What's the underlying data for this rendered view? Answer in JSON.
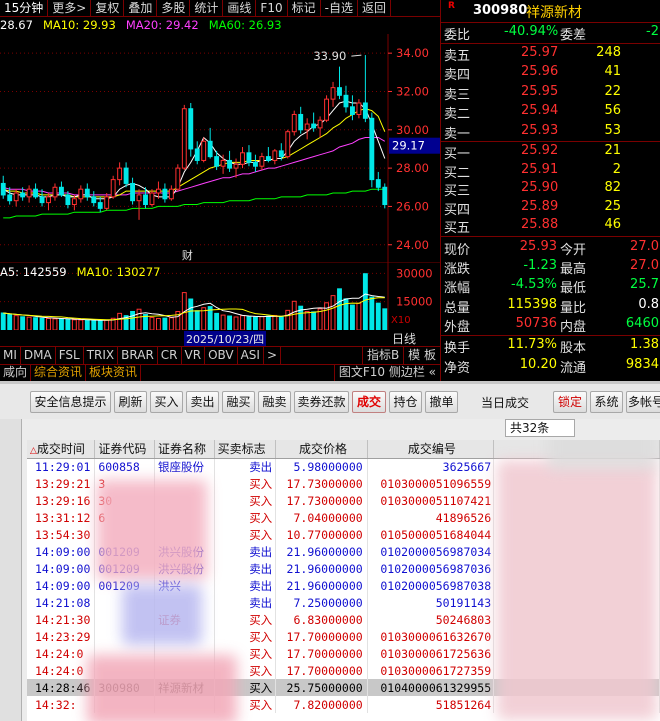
{
  "top_menu": {
    "items": [
      {
        "label": "15分钟",
        "active": true
      },
      {
        "label": "更多>"
      },
      {
        "label": "复权"
      },
      {
        "label": "叠加"
      },
      {
        "label": "多股"
      },
      {
        "label": "统计"
      },
      {
        "label": "画线"
      },
      {
        "label": "F10"
      },
      {
        "label": "标记"
      },
      {
        "label": "-自选"
      },
      {
        "label": "返回"
      }
    ]
  },
  "price_legend": [
    {
      "text": "28.67",
      "color": "#ffffff"
    },
    {
      "text": "MA10: 29.93",
      "color": "#ffff00"
    },
    {
      "text": "MA20: 29.42",
      "color": "#ff40ff"
    },
    {
      "text": "MA60: 26.93",
      "color": "#00ff00"
    }
  ],
  "colors": {
    "up": "#ff3030",
    "down": "#00e8e8",
    "ma5": "#ffffff",
    "ma10": "#ffff00",
    "ma20": "#ff40ff",
    "ma60": "#00ff00",
    "grid": "#7a0000",
    "price_axis": "#ff3030"
  },
  "chart_data": [
    {
      "type": "candlestick",
      "period": "15分钟",
      "ylim": [
        23.1,
        35.0
      ],
      "y_ticks": [
        "34.00",
        "32.00",
        "30.00",
        "28.00",
        "26.00",
        "24.00"
      ],
      "current_price_label": "29.17",
      "high_annotation": "33.90",
      "event_marker": "财",
      "date_label": "2025/10/23/四",
      "candles": [
        [
          27.2,
          27.6,
          26.4,
          26.6
        ],
        [
          26.6,
          27.0,
          26.1,
          26.3
        ],
        [
          26.3,
          26.9,
          26.0,
          26.7
        ],
        [
          26.7,
          27.0,
          26.3,
          26.5
        ],
        [
          26.5,
          27.1,
          26.2,
          26.9
        ],
        [
          26.9,
          27.2,
          26.4,
          26.5
        ],
        [
          26.5,
          26.9,
          26.0,
          26.2
        ],
        [
          26.2,
          26.7,
          25.8,
          26.5
        ],
        [
          26.5,
          27.2,
          26.3,
          27.0
        ],
        [
          27.0,
          27.3,
          26.5,
          26.6
        ],
        [
          26.6,
          26.8,
          25.9,
          26.1
        ],
        [
          26.1,
          26.6,
          25.8,
          26.4
        ],
        [
          26.4,
          27.1,
          26.2,
          26.9
        ],
        [
          26.9,
          27.2,
          26.3,
          26.5
        ],
        [
          26.5,
          26.8,
          26.0,
          26.2
        ],
        [
          26.2,
          26.5,
          25.7,
          25.9
        ],
        [
          25.9,
          26.7,
          25.8,
          26.5
        ],
        [
          26.5,
          27.6,
          26.4,
          27.4
        ],
        [
          27.4,
          28.3,
          27.1,
          28.0
        ],
        [
          28.0,
          28.3,
          27.0,
          27.2
        ],
        [
          27.2,
          27.5,
          26.1,
          26.3
        ],
        [
          26.3,
          26.9,
          25.3,
          26.6
        ],
        [
          26.6,
          27.0,
          25.9,
          26.1
        ],
        [
          26.1,
          26.9,
          26.0,
          26.7
        ],
        [
          26.7,
          27.3,
          26.4,
          26.9
        ],
        [
          26.9,
          27.2,
          26.2,
          26.4
        ],
        [
          26.4,
          27.1,
          26.3,
          26.9
        ],
        [
          26.9,
          28.2,
          26.8,
          28.0
        ],
        [
          28.0,
          31.3,
          27.9,
          31.1
        ],
        [
          31.1,
          31.4,
          28.6,
          29.0
        ],
        [
          29.0,
          29.4,
          28.2,
          28.4
        ],
        [
          28.4,
          29.6,
          28.3,
          29.4
        ],
        [
          29.4,
          30.1,
          28.5,
          28.6
        ],
        [
          28.6,
          28.9,
          27.9,
          28.1
        ],
        [
          28.1,
          28.7,
          27.7,
          28.4
        ],
        [
          28.4,
          28.9,
          27.8,
          28.0
        ],
        [
          28.0,
          28.5,
          27.5,
          28.2
        ],
        [
          28.2,
          29.1,
          28.0,
          28.8
        ],
        [
          28.8,
          29.2,
          28.1,
          28.3
        ],
        [
          28.3,
          28.7,
          27.8,
          28.1
        ],
        [
          28.1,
          28.8,
          27.9,
          28.6
        ],
        [
          28.6,
          29.1,
          28.3,
          28.4
        ],
        [
          28.4,
          29.0,
          28.2,
          28.9
        ],
        [
          28.9,
          29.3,
          28.4,
          28.6
        ],
        [
          28.6,
          30.0,
          28.5,
          29.9
        ],
        [
          29.9,
          31.0,
          29.7,
          30.8
        ],
        [
          30.8,
          31.2,
          29.8,
          30.0
        ],
        [
          30.0,
          30.6,
          29.5,
          30.3
        ],
        [
          30.3,
          30.9,
          29.9,
          30.1
        ],
        [
          30.1,
          30.7,
          29.6,
          30.5
        ],
        [
          30.5,
          31.8,
          30.4,
          31.6
        ],
        [
          31.6,
          32.5,
          31.2,
          32.2
        ],
        [
          32.2,
          33.3,
          31.6,
          31.8
        ],
        [
          31.8,
          32.3,
          30.9,
          31.2
        ],
        [
          31.2,
          31.8,
          30.5,
          30.8
        ],
        [
          30.8,
          31.6,
          30.6,
          31.4
        ],
        [
          31.4,
          33.9,
          30.4,
          30.6
        ],
        [
          30.6,
          30.9,
          27.0,
          27.4
        ],
        [
          27.4,
          27.8,
          26.8,
          27.0
        ],
        [
          27.0,
          27.2,
          25.9,
          26.1
        ]
      ],
      "ma5": [
        26.9,
        26.7,
        26.6,
        26.6,
        26.6,
        26.6,
        26.5,
        26.5,
        26.6,
        26.6,
        26.5,
        26.5,
        26.6,
        26.6,
        26.4,
        26.4,
        26.4,
        26.5,
        26.9,
        27.1,
        27.2,
        27.1,
        26.9,
        26.6,
        26.5,
        26.5,
        26.5,
        27.0,
        27.8,
        28.3,
        28.9,
        29.6,
        29.3,
        28.8,
        28.5,
        28.3,
        28.2,
        28.2,
        28.3,
        28.3,
        28.4,
        28.4,
        28.5,
        28.5,
        28.9,
        29.4,
        29.7,
        29.9,
        30.2,
        30.3,
        30.6,
        31.0,
        31.4,
        31.5,
        31.4,
        31.4,
        31.1,
        30.3,
        29.4,
        28.5
      ],
      "ma10": [
        26.9,
        26.8,
        26.8,
        26.7,
        26.7,
        26.7,
        26.6,
        26.6,
        26.6,
        26.6,
        26.6,
        26.5,
        26.5,
        26.5,
        26.5,
        26.5,
        26.5,
        26.5,
        26.6,
        26.8,
        26.8,
        26.8,
        26.8,
        26.8,
        26.8,
        26.8,
        26.8,
        27.0,
        27.2,
        27.4,
        27.6,
        27.8,
        28.0,
        28.1,
        28.2,
        28.3,
        28.3,
        28.3,
        28.4,
        28.4,
        28.4,
        28.4,
        28.5,
        28.5,
        28.6,
        28.8,
        29.0,
        29.2,
        29.4,
        29.6,
        29.8,
        30.1,
        30.3,
        30.6,
        30.8,
        31.0,
        31.1,
        31.0,
        30.7,
        29.9
      ],
      "ma20": [
        27.0,
        26.9,
        26.9,
        26.9,
        26.8,
        26.8,
        26.8,
        26.7,
        26.7,
        26.7,
        26.7,
        26.6,
        26.6,
        26.6,
        26.6,
        26.6,
        26.6,
        26.6,
        26.6,
        26.6,
        26.7,
        26.7,
        26.7,
        26.7,
        26.7,
        26.7,
        26.7,
        26.8,
        26.9,
        27.0,
        27.1,
        27.2,
        27.3,
        27.4,
        27.5,
        27.5,
        27.6,
        27.7,
        27.7,
        27.8,
        27.9,
        28.0,
        28.0,
        28.1,
        28.2,
        28.3,
        28.4,
        28.5,
        28.6,
        28.7,
        28.8,
        28.9,
        29.1,
        29.2,
        29.3,
        29.5,
        29.6,
        29.6,
        29.6,
        29.4
      ],
      "ma60": [
        25.4,
        25.4,
        25.5,
        25.5,
        25.5,
        25.5,
        25.6,
        25.6,
        25.6,
        25.6,
        25.6,
        25.7,
        25.7,
        25.7,
        25.7,
        25.7,
        25.8,
        25.8,
        25.8,
        25.8,
        25.9,
        25.9,
        25.9,
        25.9,
        26.0,
        26.0,
        26.0,
        26.0,
        26.1,
        26.1,
        26.1,
        26.2,
        26.2,
        26.2,
        26.2,
        26.3,
        26.3,
        26.3,
        26.3,
        26.4,
        26.4,
        26.4,
        26.4,
        26.5,
        26.5,
        26.5,
        26.5,
        26.6,
        26.6,
        26.6,
        26.6,
        26.7,
        26.7,
        26.7,
        26.8,
        26.8,
        26.8,
        26.9,
        26.9,
        26.9
      ]
    },
    {
      "type": "bar",
      "name_hidden": true,
      "ylim": [
        0,
        36000
      ],
      "y_ticks": [
        "30000",
        "15000"
      ],
      "scale_label": "X10",
      "values": [
        9000,
        8200,
        7600,
        7000,
        6800,
        6500,
        6200,
        6100,
        5900,
        5800,
        5600,
        5400,
        5300,
        5200,
        5000,
        4900,
        5200,
        6200,
        8800,
        7600,
        9800,
        11000,
        8200,
        6600,
        6100,
        6300,
        6500,
        9800,
        19800,
        16400,
        10200,
        11800,
        12400,
        8800,
        7900,
        7400,
        6900,
        7600,
        7200,
        6800,
        7100,
        7300,
        7700,
        7000,
        10400,
        15200,
        12600,
        9800,
        9600,
        11200,
        14400,
        18200,
        21800,
        16500,
        13200,
        14100,
        29800,
        17400,
        14200,
        11200
      ]
    }
  ],
  "vol_legend": [
    {
      "text": "A5: 142559",
      "color": "#ffffff"
    },
    {
      "text": "MA10: 130277",
      "color": "#ffff00"
    }
  ],
  "period_label": "日线",
  "indicator_tabs": [
    "MI",
    "DMA",
    "FSL",
    "TRIX",
    "BRAR",
    "CR",
    "VR",
    "OBV",
    "ASI",
    ">"
  ],
  "indicator_right": [
    "指标B",
    "模 板"
  ],
  "info_tabs": [
    "咸向",
    "综合资讯",
    "板块资讯"
  ],
  "info_right": "图文F10 侧边栏 «",
  "quote": {
    "r_badge": "R",
    "code": "300980",
    "name": "祥源新材",
    "weibi": {
      "label": "委比",
      "value": "-40.94%",
      "label2": "委差",
      "value2": "-2"
    },
    "asks": [
      {
        "label": "卖五",
        "price": "25.97",
        "vol": "248"
      },
      {
        "label": "卖四",
        "price": "25.96",
        "vol": "41"
      },
      {
        "label": "卖三",
        "price": "25.95",
        "vol": "22"
      },
      {
        "label": "卖二",
        "price": "25.94",
        "vol": "56"
      },
      {
        "label": "卖一",
        "price": "25.93",
        "vol": "53"
      }
    ],
    "bids": [
      {
        "label": "买一",
        "price": "25.92",
        "vol": "21"
      },
      {
        "label": "买二",
        "price": "25.91",
        "vol": "2"
      },
      {
        "label": "买三",
        "price": "25.90",
        "vol": "82"
      },
      {
        "label": "买四",
        "price": "25.89",
        "vol": "25"
      },
      {
        "label": "买五",
        "price": "25.88",
        "vol": "46"
      }
    ],
    "stats": [
      {
        "l1": "现价",
        "v1": "25.93",
        "c1": "#ff3030",
        "l2": "今开",
        "v2": "27.0",
        "c2": "#ff3030"
      },
      {
        "l1": "涨跌",
        "v1": "-1.23",
        "c1": "#00ff40",
        "l2": "最高",
        "v2": "27.0",
        "c2": "#ff3030"
      },
      {
        "l1": "涨幅",
        "v1": "-4.53%",
        "c1": "#00ff40",
        "l2": "最低",
        "v2": "25.7",
        "c2": "#00ff40"
      },
      {
        "l1": "总量",
        "v1": "115398",
        "c1": "#ffff00",
        "l2": "量比",
        "v2": "0.8",
        "c2": "#ffffff"
      },
      {
        "l1": "外盘",
        "v1": "50736",
        "c1": "#ff3030",
        "l2": "内盘",
        "v2": "6460",
        "c2": "#00ff40"
      }
    ],
    "stats2": [
      {
        "l1": "换手",
        "v1": "11.73%",
        "l2": "股本",
        "v2": "1.38"
      },
      {
        "l1": "净资",
        "v1": "10.20",
        "l2": "流通",
        "v2": "9834"
      }
    ]
  },
  "trade_toolbar": {
    "buttons": [
      "安全信息提示",
      "刷新",
      "买入",
      "卖出",
      "融买",
      "融卖",
      "卖券还款",
      "成交",
      "持仓",
      "撤单"
    ],
    "title": "当日成交",
    "right_buttons": [
      "锁定",
      "系统",
      "多帐号"
    ]
  },
  "trade_table": {
    "total_label": "共32条",
    "columns": [
      "成交时间",
      "证券代码",
      "证券名称",
      "买卖标志",
      "成交价格",
      "成交编号"
    ],
    "rows": [
      {
        "time": "11:29:01",
        "code": "600858",
        "name": "银座股份",
        "side": "卖出",
        "price": "5.98000000",
        "no": "3625667",
        "color": "blue"
      },
      {
        "time": "13:29:21",
        "code": "3",
        "name": "",
        "side": "买入",
        "price": "17.73000000",
        "no": "0103000051096559",
        "color": "red"
      },
      {
        "time": "13:29:16",
        "code": "30",
        "name": "",
        "side": "买入",
        "price": "17.73000000",
        "no": "0103000051107421",
        "color": "red"
      },
      {
        "time": "13:31:12",
        "code": "6",
        "name": "",
        "side": "买入",
        "price": "7.04000000",
        "no": "41896526",
        "color": "red"
      },
      {
        "time": "13:54:30",
        "code": "",
        "name": "",
        "side": "买入",
        "price": "10.77000000",
        "no": "0105000051684044",
        "color": "red"
      },
      {
        "time": "14:09:00",
        "code": "001209",
        "name": "洪兴股份",
        "side": "卖出",
        "price": "21.96000000",
        "no": "0102000056987034",
        "color": "blue"
      },
      {
        "time": "14:09:00",
        "code": "001209",
        "name": "洪兴股份",
        "side": "卖出",
        "price": "21.96000000",
        "no": "0102000056987036",
        "color": "blue"
      },
      {
        "time": "14:09:00",
        "code": "001209",
        "name": "洪兴",
        "side": "卖出",
        "price": "21.96000000",
        "no": "0102000056987038",
        "color": "blue"
      },
      {
        "time": "14:21:08",
        "code": "",
        "name": "",
        "side": "卖出",
        "price": "7.25000000",
        "no": "50191143",
        "color": "blue"
      },
      {
        "time": "14:21:30",
        "code": "",
        "name": "证券",
        "side": "买入",
        "price": "6.83000000",
        "no": "50246803",
        "color": "red"
      },
      {
        "time": "14:23:29",
        "code": "",
        "name": "",
        "side": "买入",
        "price": "17.70000000",
        "no": "0103000061632670",
        "color": "red"
      },
      {
        "time": "14:24:0",
        "code": "",
        "name": "",
        "side": "买入",
        "price": "17.70000000",
        "no": "0103000061725636",
        "color": "red"
      },
      {
        "time": "14:24:0",
        "code": "",
        "name": "",
        "side": "买入",
        "price": "17.70000000",
        "no": "0103000061727359",
        "color": "red"
      },
      {
        "time": "14:28:46",
        "code": "300980",
        "name": "祥源新材",
        "side": "买入",
        "price": "25.75000000",
        "no": "0104000061329955",
        "color": "sel"
      },
      {
        "time": "14:32:",
        "code": "",
        "name": "",
        "side": "买入",
        "price": "7.82000000",
        "no": "51851264",
        "color": "red"
      }
    ]
  }
}
